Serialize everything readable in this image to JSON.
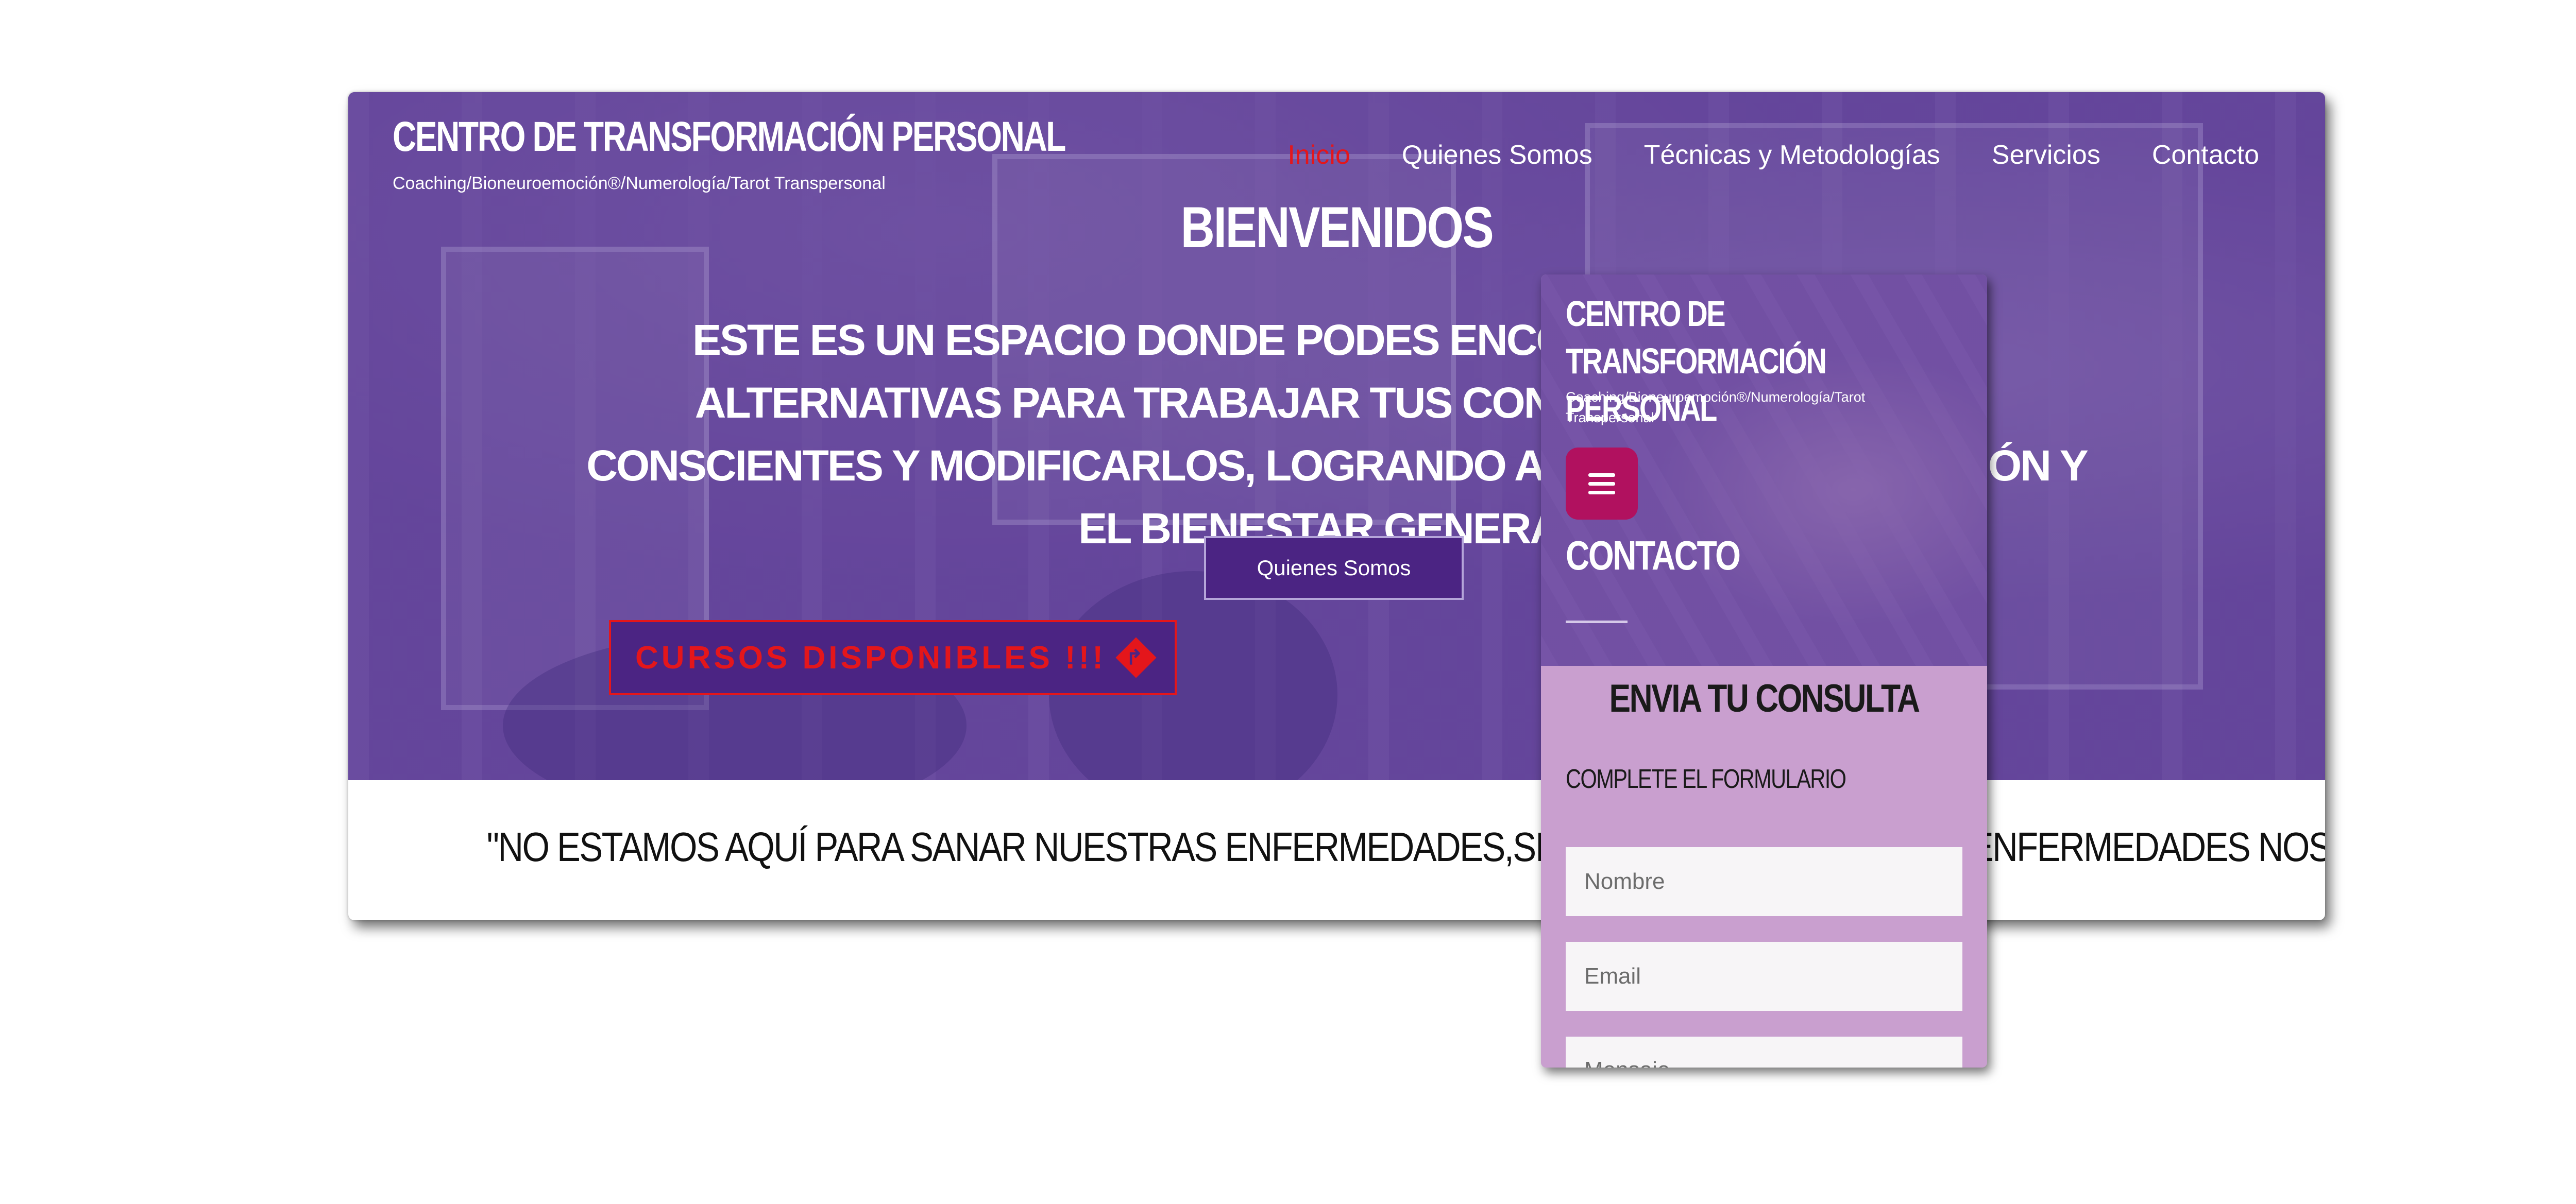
{
  "desktop": {
    "site_title": "CENTRO DE TRANSFORMACIÓN PERSONAL",
    "tagline": "Coaching/Bioneuroemoción®/Numerología/Tarot Transpersonal",
    "nav": [
      {
        "label": "Inicio",
        "active": true
      },
      {
        "label": "Quienes Somos",
        "active": false
      },
      {
        "label": "Técnicas y Metodologías",
        "active": false
      },
      {
        "label": "Servicios",
        "active": false
      },
      {
        "label": "Contacto",
        "active": false
      }
    ],
    "hero": {
      "heading": "BIENVENIDOS",
      "text": "ESTE ES UN ESPACIO DONDE PODES ENCONTRAR DIFERENTES ALTERNATIVAS PARA TRABAJAR TUS CONFLICTOS, HACERLOS CONSCIENTES Y MODIFICARLOS, LOGRANDO ASÍ LA TRANSFORMACIÓN Y EL BIENESTAR GENERAL.",
      "button_label": "Quienes Somos",
      "courses_label": "CURSOS DISPONIBLES !!!"
    },
    "quote": "\"NO ESTAMOS AQUÍ PARA SANAR NUESTRAS ENFERMEDADES,SINO PARA QUE NUESTRAS ENFERMEDADES NOS SANEN\". CARL GUSTAV JUNG"
  },
  "mobile": {
    "site_title": "CENTRO DE TRANSFORMACIÓN PERSONAL",
    "tagline": "Coaching/Bioneuroemoción®/Numerología/Tarot Transpersonal",
    "page_title": "CONTACTO",
    "form_title": "ENVIA TU CONSULTA",
    "form_subtitle": "COMPLETE EL FORMULARIO",
    "name_placeholder": "Nombre",
    "email_placeholder": "Email",
    "message_placeholder": "Mensaje"
  },
  "colors": {
    "accent_red": "#e4161b",
    "brand_purple": "#4b2483",
    "menu_magenta": "#b1115f",
    "form_bg": "#c99fcf"
  },
  "icons": [
    "directions-diamond-icon",
    "hamburger-menu-icon"
  ]
}
